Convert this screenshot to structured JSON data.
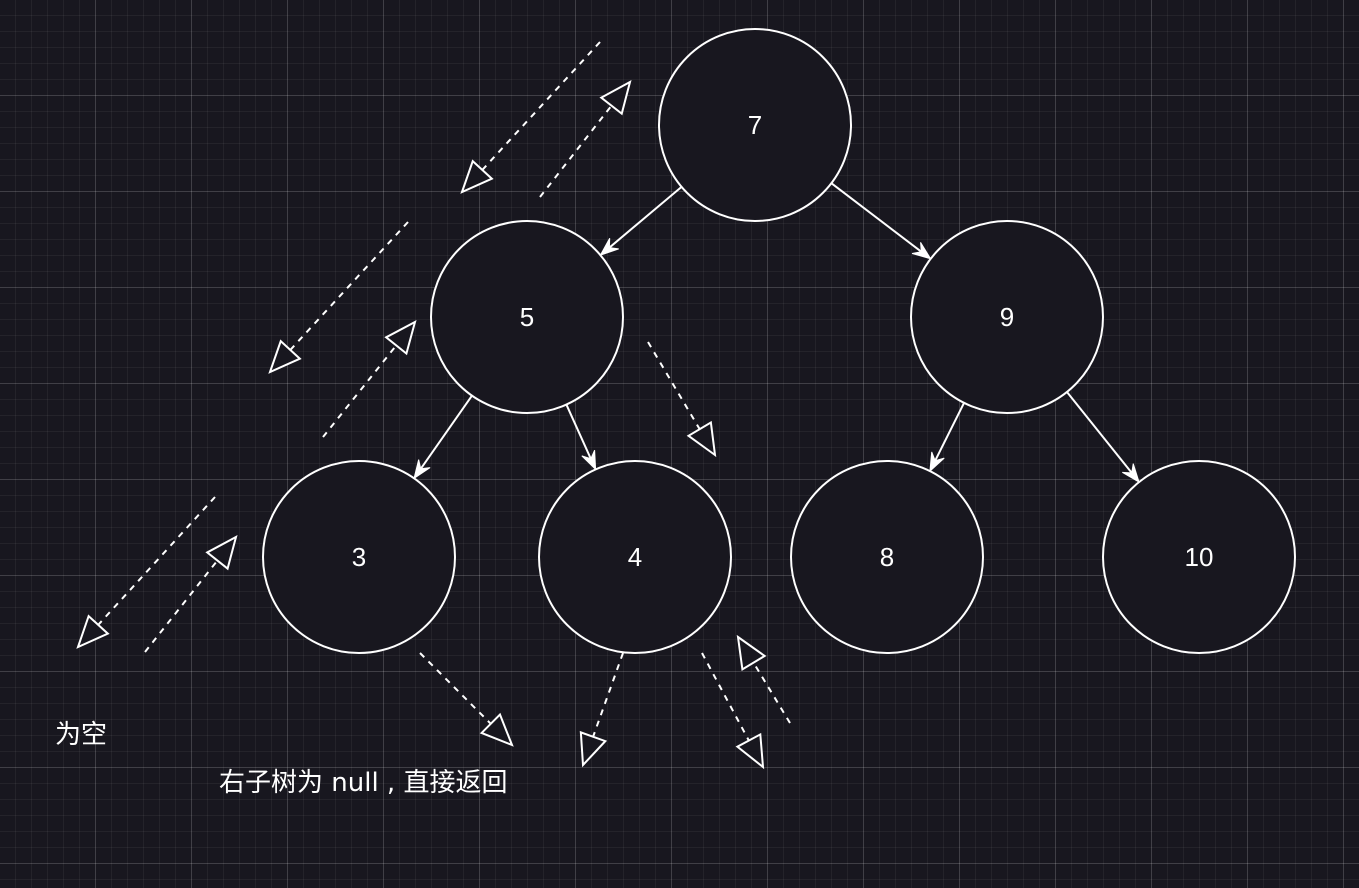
{
  "nodes": [
    {
      "id": "n7",
      "label": "7"
    },
    {
      "id": "n5",
      "label": "5"
    },
    {
      "id": "n9",
      "label": "9"
    },
    {
      "id": "n3",
      "label": "3"
    },
    {
      "id": "n4",
      "label": "4"
    },
    {
      "id": "n8",
      "label": "8"
    },
    {
      "id": "n10",
      "label": "10"
    }
  ],
  "edges": [
    {
      "from": "7",
      "to": "5"
    },
    {
      "from": "7",
      "to": "9"
    },
    {
      "from": "5",
      "to": "3"
    },
    {
      "from": "5",
      "to": "4"
    },
    {
      "from": "9",
      "to": "8"
    },
    {
      "from": "9",
      "to": "10"
    }
  ],
  "annotations": {
    "empty_label": "为空",
    "right_null_label": "右子树为 null , 直接返回"
  },
  "colors": {
    "background": "#18171f",
    "stroke": "#ffffff"
  }
}
